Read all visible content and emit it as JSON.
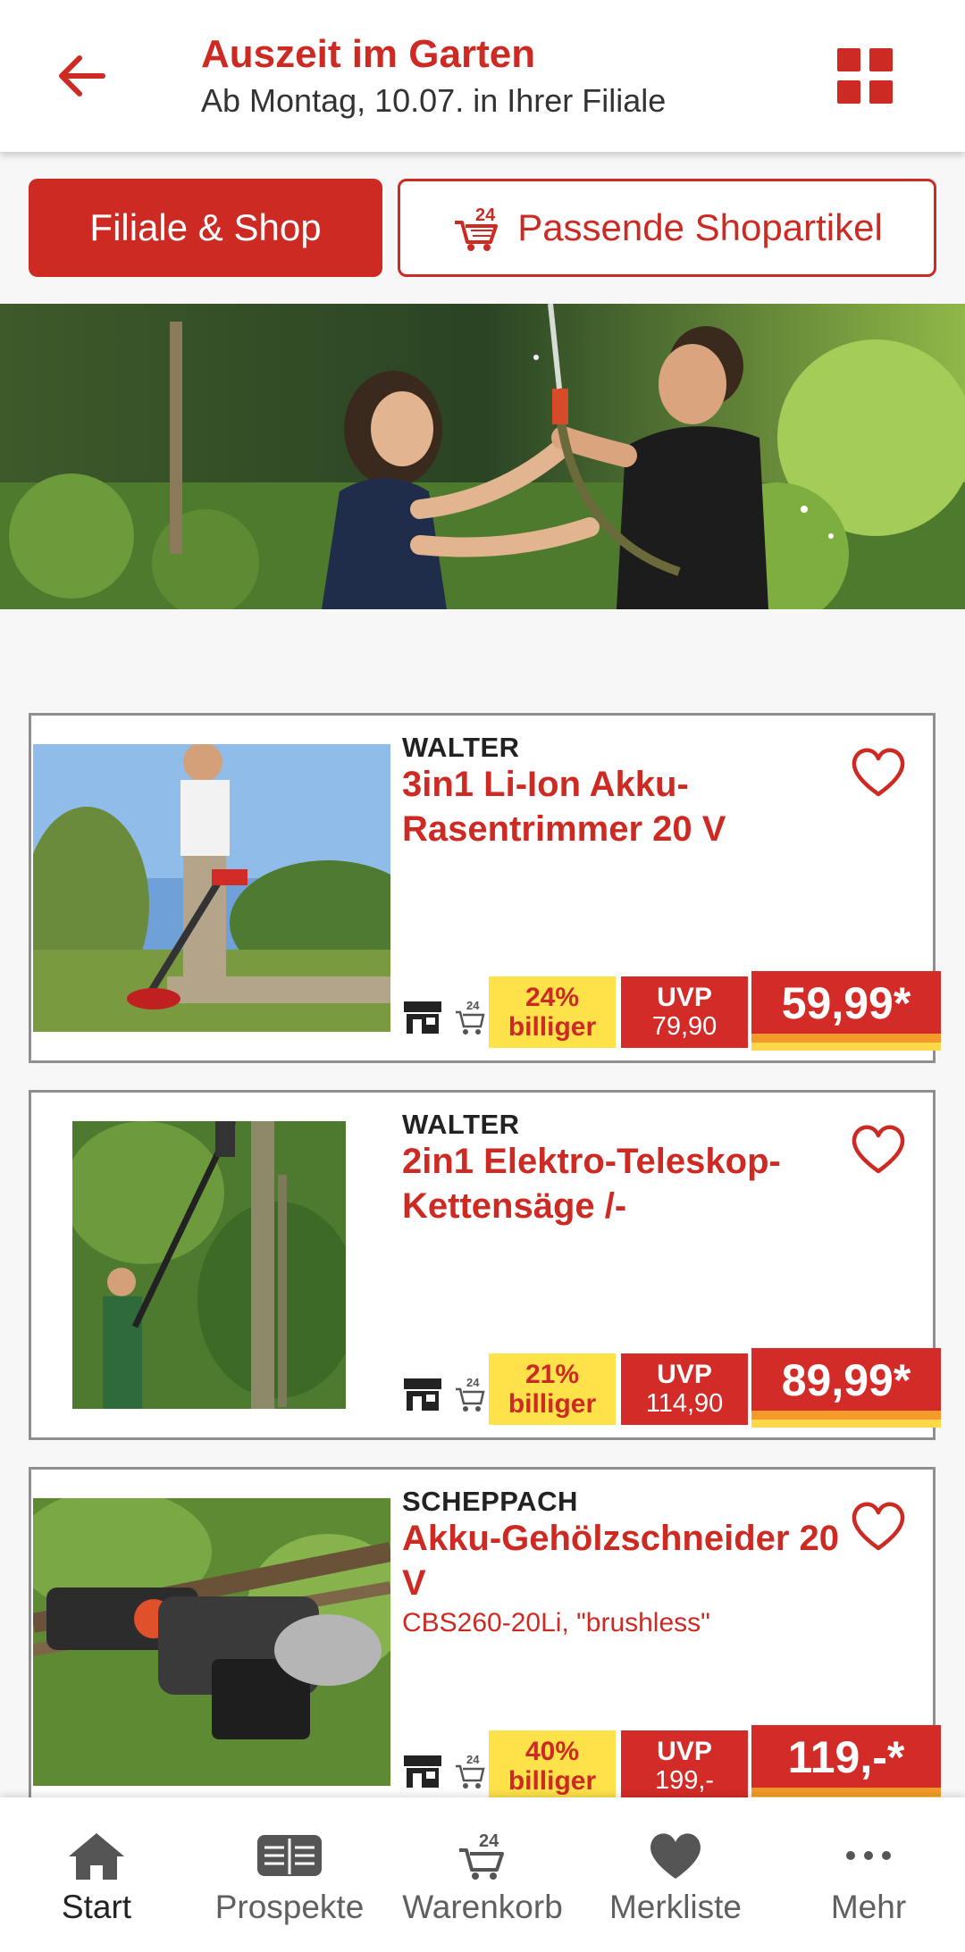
{
  "header": {
    "title": "Auszeit im Garten",
    "subtitle": "Ab Montag, 10.07. in Ihrer Filiale",
    "back_icon": "arrow-left-icon",
    "grid_icon": "grid-icon"
  },
  "segments": {
    "filiale_label": "Filiale & Shop",
    "shop_label": "Passende Shopartikel",
    "shop_icon": "cart-24-icon"
  },
  "products": [
    {
      "brand": "WALTER",
      "name": "3in1 Li-Ion Akku-Rasentrimmer 20 V",
      "subtitle": "",
      "discount_pct": "24%",
      "discount_word": "billiger",
      "uvp_label": "UVP",
      "uvp": "79,90",
      "price": "59,99*"
    },
    {
      "brand": "WALTER",
      "name": "2in1 Elektro-Teleskop-Kettensäge /-",
      "subtitle": "",
      "discount_pct": "21%",
      "discount_word": "billiger",
      "uvp_label": "UVP",
      "uvp": "114,90",
      "price": "89,99*"
    },
    {
      "brand": "SCHEPPACH",
      "name": "Akku-Gehölzschneider 20 V",
      "subtitle": "CBS260-20Li, \"brushless\"",
      "discount_pct": "40%",
      "discount_word": "billiger",
      "uvp_label": "UVP",
      "uvp": "199,-",
      "price": "119,-*"
    }
  ],
  "nav": {
    "start": "Start",
    "prospekte": "Prospekte",
    "warenkorb": "Warenkorb",
    "merkliste": "Merkliste",
    "mehr": "Mehr"
  },
  "colors": {
    "brand_red": "#cc2a22",
    "discount_yellow": "#ffe14a",
    "price_stripe_orange": "#f39a2a"
  }
}
